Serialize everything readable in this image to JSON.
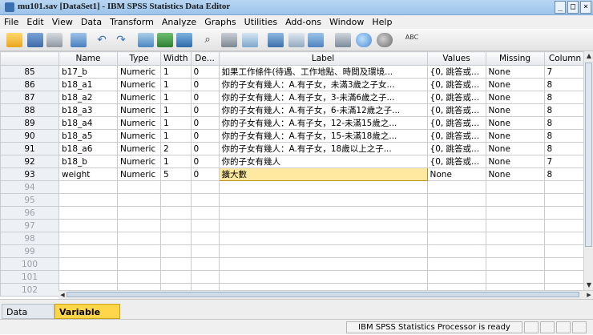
{
  "window": {
    "title": "mu101.sav [DataSet1] - IBM SPSS Statistics Data Editor",
    "controls": [
      "_",
      "□",
      "×"
    ]
  },
  "menu": [
    "File",
    "Edit",
    "View",
    "Data",
    "Transform",
    "Analyze",
    "Graphs",
    "Utilities",
    "Add-ons",
    "Window",
    "Help"
  ],
  "toolbar": {
    "icons": [
      "open-folder-icon",
      "save-icon",
      "print-icon",
      "dialog-recall-icon",
      "undo-icon",
      "redo-icon",
      "goto-case-icon",
      "goto-variable-icon",
      "variables-icon",
      "find-icon",
      "insert-cases-icon",
      "insert-variable-icon",
      "split-file-icon",
      "weight-cases-icon",
      "select-cases-icon",
      "value-labels-icon",
      "use-sets-icon",
      "show-all-variables-icon",
      "spell-check-icon"
    ],
    "spell_label": "ABC"
  },
  "grid": {
    "columns": [
      "Name",
      "Type",
      "Width",
      "De...",
      "Label",
      "Values",
      "Missing",
      "Column"
    ],
    "rows": [
      {
        "num": "85",
        "name": "b17_b",
        "type": "Numeric",
        "width": "1",
        "decimals": "0",
        "label": "如果工作條件(待遇、工作地點、時間及環境...",
        "values": "{0, 跳答或...",
        "missing": "None",
        "columns": "7"
      },
      {
        "num": "86",
        "name": "b18_a1",
        "type": "Numeric",
        "width": "1",
        "decimals": "0",
        "label": "你的子女有幾人：A.有子女，未滿3歲之子女...",
        "values": "{0, 跳答或...",
        "missing": "None",
        "columns": "8"
      },
      {
        "num": "87",
        "name": "b18_a2",
        "type": "Numeric",
        "width": "1",
        "decimals": "0",
        "label": "你的子女有幾人：A.有子女，3-未滿6歲之子...",
        "values": "{0, 跳答或...",
        "missing": "None",
        "columns": "8"
      },
      {
        "num": "88",
        "name": "b18_a3",
        "type": "Numeric",
        "width": "1",
        "decimals": "0",
        "label": "你的子女有幾人：A.有子女，6-未滿12歲之子...",
        "values": "{0, 跳答或...",
        "missing": "None",
        "columns": "8"
      },
      {
        "num": "89",
        "name": "b18_a4",
        "type": "Numeric",
        "width": "1",
        "decimals": "0",
        "label": "你的子女有幾人：A.有子女，12-未滿15歲之...",
        "values": "{0, 跳答或...",
        "missing": "None",
        "columns": "8"
      },
      {
        "num": "90",
        "name": "b18_a5",
        "type": "Numeric",
        "width": "1",
        "decimals": "0",
        "label": "你的子女有幾人：A.有子女，15-未滿18歲之...",
        "values": "{0, 跳答或...",
        "missing": "None",
        "columns": "8"
      },
      {
        "num": "91",
        "name": "b18_a6",
        "type": "Numeric",
        "width": "2",
        "decimals": "0",
        "label": "你的子女有幾人：A.有子女，18歲以上之子...",
        "values": "{0, 跳答或...",
        "missing": "None",
        "columns": "8"
      },
      {
        "num": "92",
        "name": "b18_b",
        "type": "Numeric",
        "width": "1",
        "decimals": "0",
        "label": "你的子女有幾人",
        "values": "{0, 跳答或...",
        "missing": "None",
        "columns": "7"
      },
      {
        "num": "93",
        "name": "weight",
        "type": "Numeric",
        "width": "5",
        "decimals": "0",
        "label": "擴大數",
        "values": "None",
        "missing": "None",
        "columns": "8"
      }
    ],
    "empty_rows": [
      "94",
      "95",
      "96",
      "97",
      "98",
      "99",
      "100",
      "101",
      "102"
    ],
    "selected_cell": {
      "row": "93",
      "column": "Label"
    }
  },
  "tabs": [
    "Data View",
    "Variable View"
  ],
  "active_tab": "Variable View",
  "status": "IBM SPSS Statistics Processor is ready",
  "colors": {
    "active_tab": "#ffd54a",
    "selected_cell": "#ffe9a0",
    "row_header": "#edf1f6"
  }
}
